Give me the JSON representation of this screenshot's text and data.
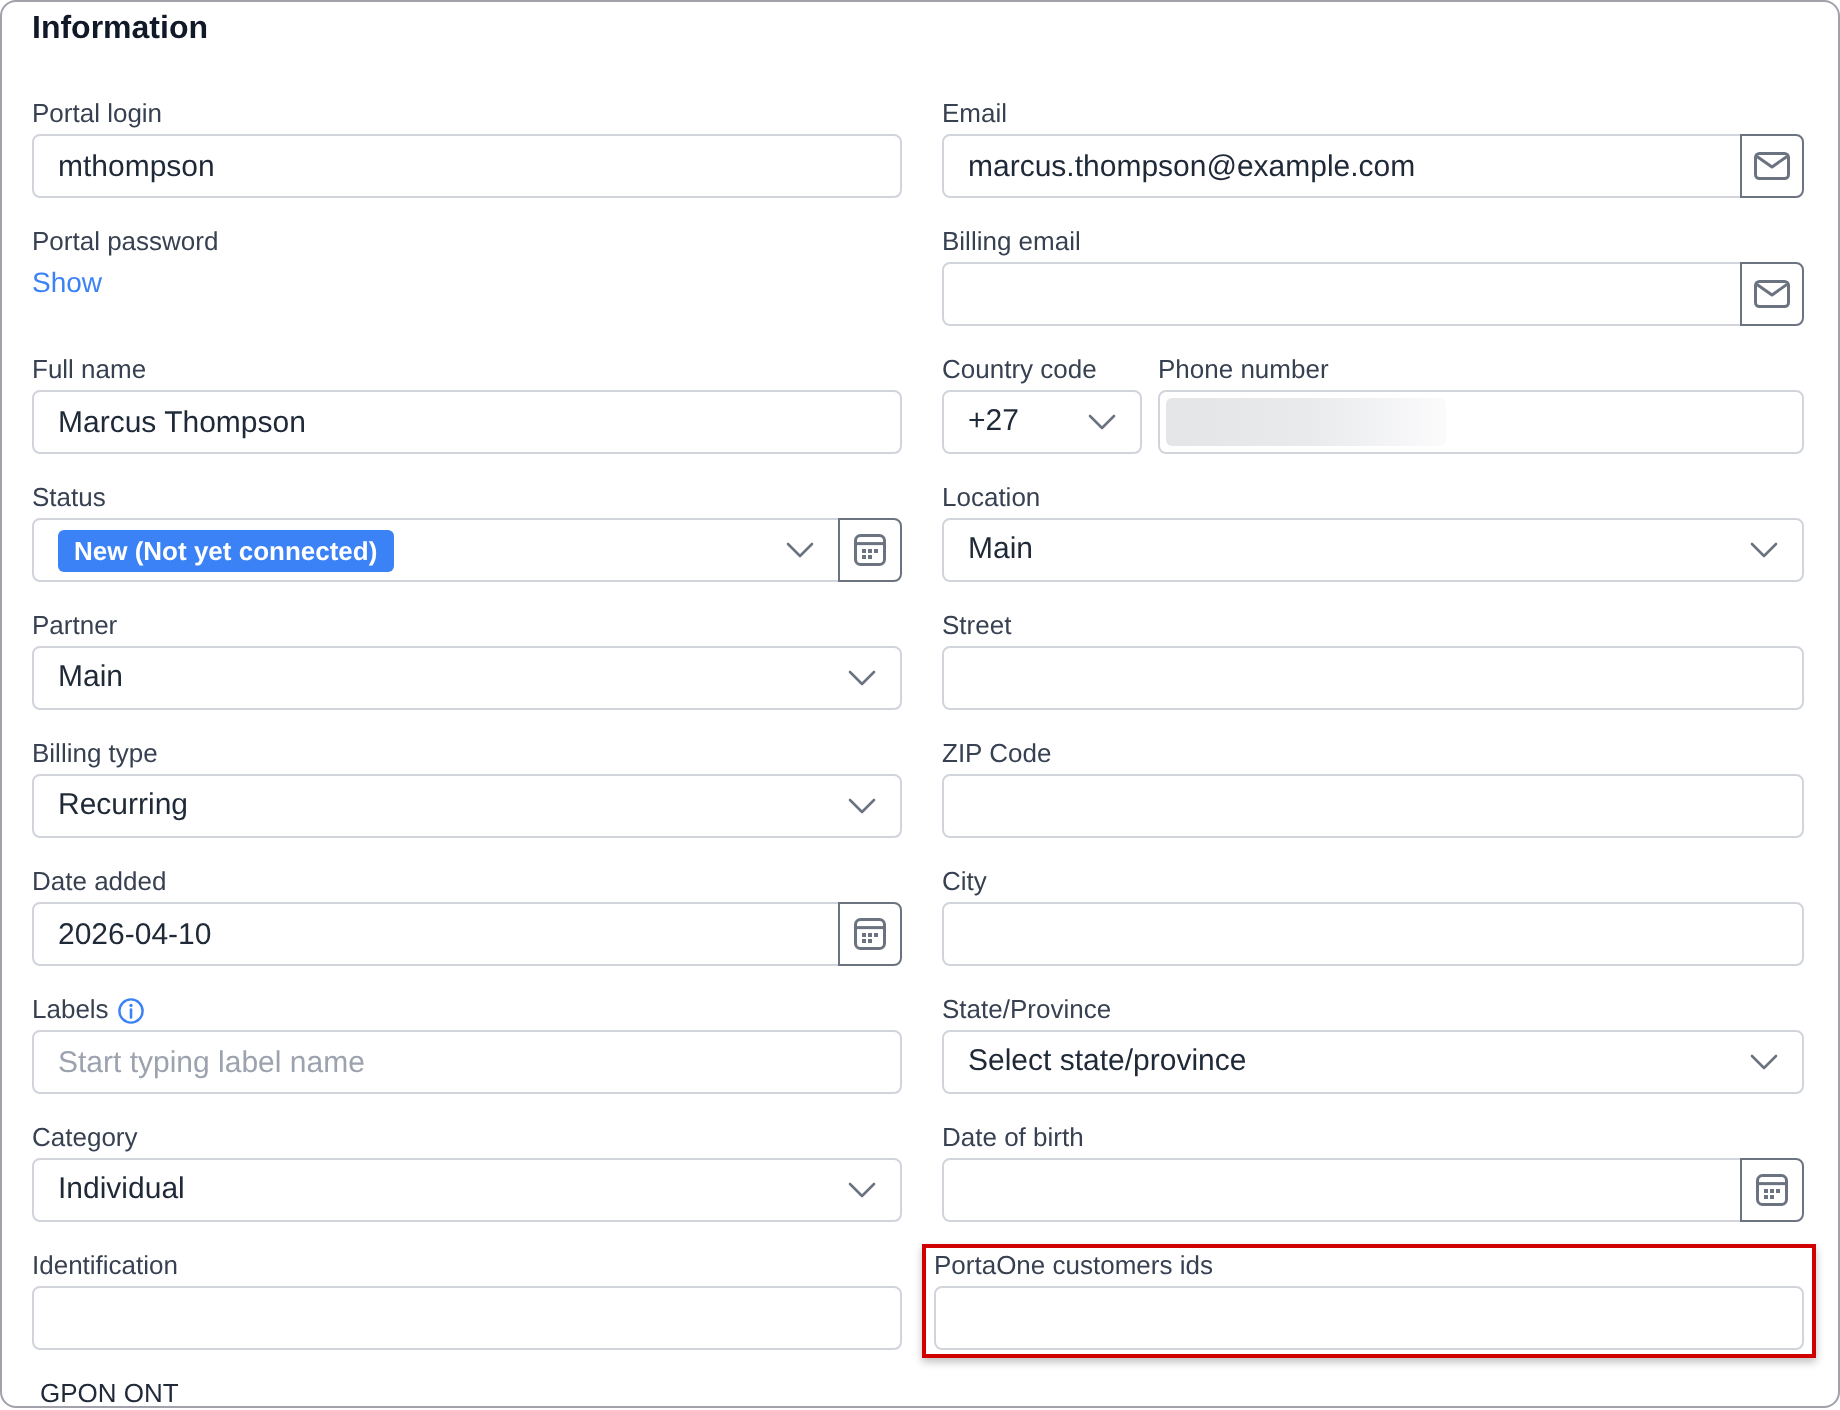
{
  "section": {
    "title": "Information"
  },
  "columns": [
    {
      "fields": [
        {
          "kind": "text",
          "label": "Portal login",
          "value": "mthompson"
        },
        {
          "kind": "password",
          "label": "Portal password",
          "link": "Show"
        },
        {
          "kind": "text",
          "label": "Full name",
          "value": "Marcus Thompson"
        },
        {
          "kind": "status",
          "label": "Status",
          "badge": "New (Not yet connected)"
        },
        {
          "kind": "select",
          "label": "Partner",
          "value": "Main"
        },
        {
          "kind": "select",
          "label": "Billing type",
          "value": "Recurring"
        },
        {
          "kind": "date",
          "label": "Date added",
          "value": "2026-04-10"
        },
        {
          "kind": "text",
          "label": "Labels",
          "info": true,
          "placeholder": "Start typing label name"
        },
        {
          "kind": "select",
          "label": "Category",
          "value": "Individual"
        },
        {
          "kind": "text",
          "label": "Identification"
        }
      ]
    },
    {
      "fields": [
        {
          "kind": "email",
          "label": "Email",
          "value": "marcus.thompson@example.com"
        },
        {
          "kind": "email",
          "label": "Billing email"
        },
        {
          "kind": "phone",
          "country_code": {
            "label": "Country code",
            "value": "+27"
          },
          "phone_number": {
            "label": "Phone number",
            "blurred": true
          }
        },
        {
          "kind": "select",
          "label": "Location",
          "value": "Main"
        },
        {
          "kind": "text",
          "label": "Street"
        },
        {
          "kind": "text",
          "label": "ZIP Code"
        },
        {
          "kind": "text",
          "label": "City"
        },
        {
          "kind": "select",
          "label": "State/Province",
          "value": "Select state/province"
        },
        {
          "kind": "date",
          "label": "Date of birth"
        },
        {
          "kind": "text",
          "label": "PortaOne customers ids",
          "highlighted": true
        }
      ]
    }
  ],
  "next_section": {
    "title": "GPON ONT"
  }
}
